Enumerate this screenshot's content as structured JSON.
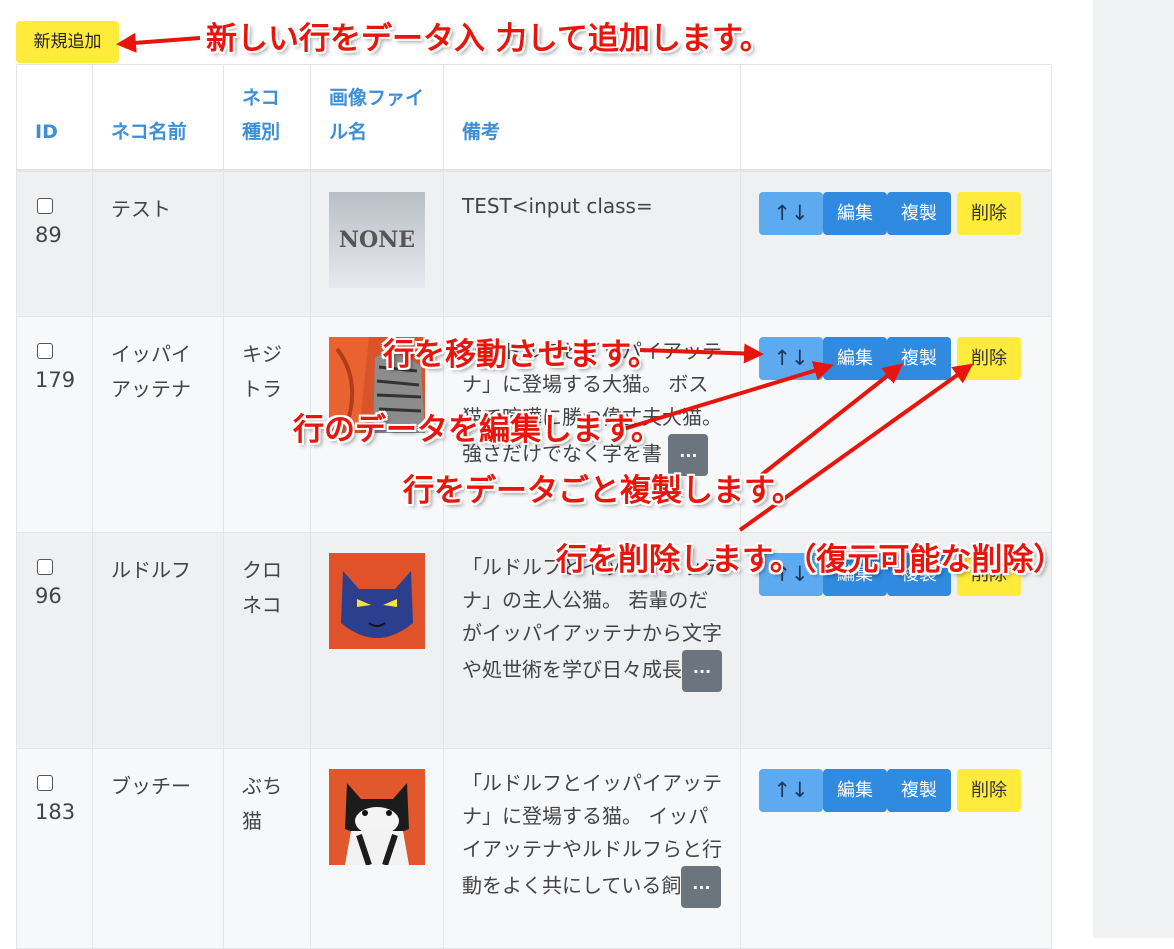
{
  "add_button": {
    "label": "新規追加"
  },
  "table": {
    "headers": {
      "id": "ID",
      "name": "ネコ名前",
      "type": "ネコ種別",
      "image": "画像ファイル名",
      "memo": "備考"
    },
    "rows": [
      {
        "id": "89",
        "name": "テスト",
        "type": "",
        "image": "NONE",
        "memo": "TEST<input class=",
        "has_more": false
      },
      {
        "id": "179",
        "name": "イッパイアッテナ",
        "type": "キジトラ",
        "image": "cat-tabby",
        "memo": "「ルドルフとイッパイアッテナ」に登場する大猫。 ボス猫で喧嘩に勝つ偉丈夫大猫。強さだけでなく字を書",
        "has_more": true
      },
      {
        "id": "96",
        "name": "ルドルフ",
        "type": "クロネコ",
        "image": "cat-black",
        "memo": "「ルドルフとイッパイアッテナ」の主人公猫。 若輩のだがイッパイアッテナから文字や処世術を学び日々成長",
        "has_more": true
      },
      {
        "id": "183",
        "name": "ブッチー",
        "type": "ぶち猫",
        "image": "cat-bw",
        "memo": "「ルドルフとイッパイアッテナ」に登場する猫。 イッパイアッテナやルドルフらと行動をよく共にしている飼",
        "has_more": true
      }
    ],
    "more_label": "...",
    "actions": {
      "move": "↑↓",
      "edit": "編集",
      "copy": "複製",
      "delete": "削除"
    }
  },
  "annotations": {
    "add": "新しい行をデータ入 力して追加します。",
    "move": "行を移動させます。",
    "edit": "行のデータを編集します。",
    "copy": "行をデータごと複製します。",
    "delete": "行を削除します。（復元可能な削除）"
  },
  "colors": {
    "accent": "#3d8fd6",
    "primary_btn": "#2f8ae0",
    "light_btn": "#5eaaf0",
    "warning_btn": "#ffeb3b",
    "annotation": "#e8150c"
  }
}
